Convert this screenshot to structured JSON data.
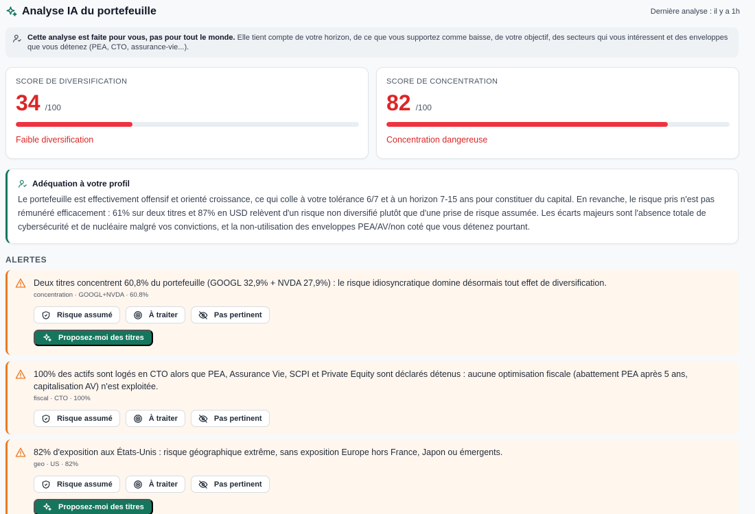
{
  "header": {
    "title": "Analyse IA du portefeuille",
    "last_analysis": "Dernière analyse : il y a 1h",
    "icon": "sparkles-icon"
  },
  "info": {
    "bold": "Cette analyse est faite pour vous, pas pour tout le monde.",
    "text": " Elle tient compte de votre horizon, de ce que vous supportez comme baisse, de votre objectif, des secteurs qui vous intéressent et des enveloppes que vous détenez (PEA, CTO, assurance-vie...).",
    "icon": "user-icon"
  },
  "scores": [
    {
      "label": "SCORE DE DIVERSIFICATION",
      "value": "34",
      "denominator": "/100",
      "fraction": 0.34,
      "description": "Faible diversification",
      "color": "#dc2626"
    },
    {
      "label": "SCORE DE CONCENTRATION",
      "value": "82",
      "denominator": "/100",
      "fraction": 0.82,
      "description": "Concentration dangereuse",
      "color": "#dc2626"
    }
  ],
  "profile": {
    "title": "Adéquation à votre profil",
    "text": "Le portefeuille est effectivement offensif et orienté croissance, ce qui colle à votre tolérance 6/7 et à un horizon 7-15 ans pour constituer du capital. En revanche, le risque pris n'est pas rémunéré efficacement : 61% sur deux titres et 87% en USD relèvent d'un risque non diversifié plutôt que d'une prise de risque assumée. Les écarts majeurs sont l'absence totale de cybersécurité et de nucléaire malgré vos convictions, et la non-utilisation des enveloppes PEA/AV/non coté que vous détenez pourtant.",
    "accent": "#15765d"
  },
  "alerts_heading": "ALERTES",
  "buttons": {
    "risk": "Risque assumé",
    "todo": "À traiter",
    "irrelevant": "Pas pertinent",
    "propose": "Proposez-moi des titres"
  },
  "alerts": [
    {
      "text": "Deux titres concentrent 60,8% du portefeuille (GOOGL 32,9% + NVDA 27,9%) : le risque idiosyncratique domine désormais tout effet de diversification.",
      "meta": "concentration · GOOGL+NVDA · 60.8%"
    },
    {
      "text": "100% des actifs sont logés en CTO alors que PEA, Assurance Vie, SCPI et Private Equity sont déclarés détenus : aucune optimisation fiscale (abattement PEA après 5 ans, capitalisation AV) n'est exploitée.",
      "meta": "fiscal · CTO · 100%"
    },
    {
      "text": "82% d'exposition aux États-Unis : risque géographique extrême, sans exposition Europe hors France, Japon ou émergents.",
      "meta": "geo · US · 82%"
    }
  ],
  "colors": {
    "accent_green": "#15765d",
    "alert_orange": "#ea7a24",
    "danger_red": "#dc2626"
  }
}
